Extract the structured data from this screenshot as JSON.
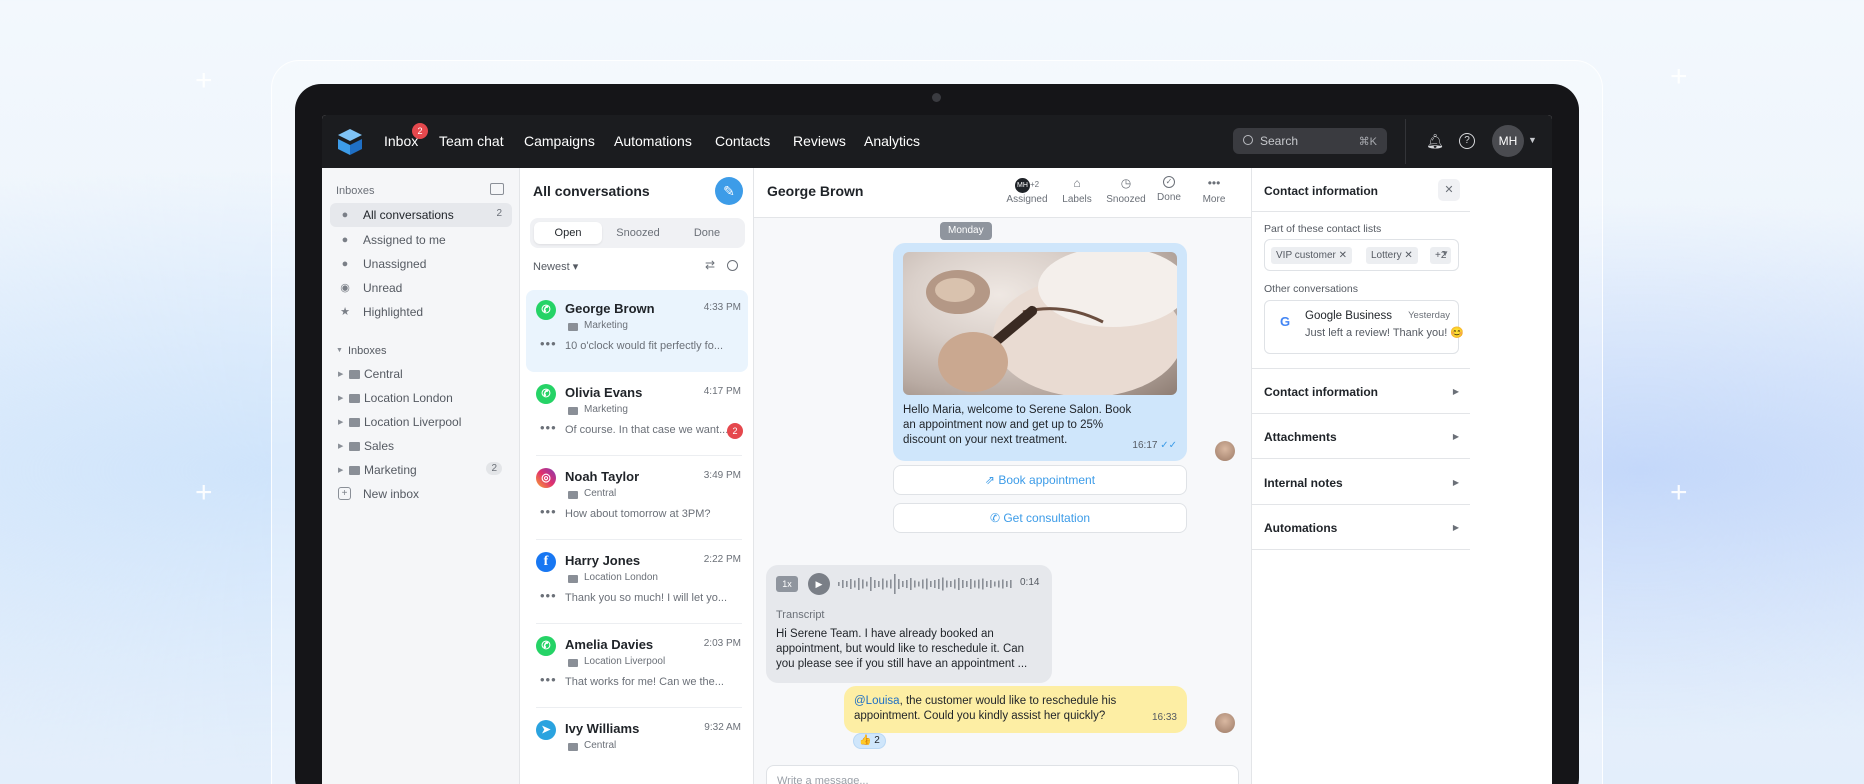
{
  "topnav": {
    "items": [
      "Inbox",
      "Team chat",
      "Campaigns",
      "Automations",
      "Contacts",
      "Reviews",
      "Analytics"
    ],
    "inbox_badge": "2",
    "search_placeholder": "Search",
    "search_shortcut": "⌘K",
    "user_initials": "MH"
  },
  "sidebar": {
    "header": "Inboxes",
    "items": [
      {
        "label": "All conversations",
        "count": "2"
      },
      {
        "label": "Assigned to me"
      },
      {
        "label": "Unassigned"
      },
      {
        "label": "Unread"
      },
      {
        "label": "Highlighted"
      }
    ],
    "section_title": "Inboxes",
    "inboxes": [
      {
        "label": "Central"
      },
      {
        "label": "Location London"
      },
      {
        "label": "Location Liverpool"
      },
      {
        "label": "Sales"
      },
      {
        "label": "Marketing",
        "count": "2"
      }
    ],
    "new_inbox": "New inbox"
  },
  "conversations": {
    "title": "All conversations",
    "tabs": [
      "Open",
      "Snoozed",
      "Done"
    ],
    "sort": "Newest",
    "items": [
      {
        "name": "George Brown",
        "time": "4:33 PM",
        "tag": "Marketing",
        "preview": "10 o'clock would fit perfectly fo...",
        "channel": "whatsapp"
      },
      {
        "name": "Olivia Evans",
        "time": "4:17 PM",
        "tag": "Marketing",
        "preview": "Of course. In that case we want...",
        "unread": "2",
        "channel": "whatsapp"
      },
      {
        "name": "Noah Taylor",
        "time": "3:49 PM",
        "tag": "Central",
        "preview": "How about tomorrow at 3PM?",
        "channel": "instagram"
      },
      {
        "name": "Harry Jones",
        "time": "2:22 PM",
        "tag": "Location London",
        "preview": "Thank you so much! I will let yo...",
        "channel": "facebook"
      },
      {
        "name": "Amelia Davies",
        "time": "2:03 PM",
        "tag": "Location Liverpool",
        "preview": "That works for me! Can we the...",
        "channel": "whatsapp"
      },
      {
        "name": "Ivy Williams",
        "time": "9:32 AM",
        "tag": "Central",
        "preview": "",
        "channel": "telegram"
      }
    ]
  },
  "chat": {
    "contact_name": "George Brown",
    "toolbar": {
      "assigned_avatar": "MH",
      "assigned_extra": "+2",
      "labels": [
        "Assigned",
        "Labels",
        "Snoozed",
        "Done",
        "More"
      ]
    },
    "day": "Monday",
    "outgoing_text": "Hello Maria, welcome to Serene Salon. Book an appointment now and get up to 25% discount on your next treatment.",
    "outgoing_time": "16:17",
    "quick_replies": [
      "Book appointment",
      "Get consultation"
    ],
    "voice": {
      "speed": "1x",
      "duration": "0:14",
      "transcript_label": "Transcript",
      "transcript": "Hi Serene Team. I have already booked an appointment, but would like to reschedule it. Can you please see if you still have an appointment ..."
    },
    "internal_note": {
      "mention": "@Louisa",
      "text": ", the customer would like to reschedule his appointment. Could you kindly assist her quickly?",
      "time": "16:33",
      "reaction_emoji": "👍",
      "reaction_count": "2"
    },
    "composer_placeholder": "Write a message..."
  },
  "contact_panel": {
    "title": "Contact information",
    "lists_label": "Part of these contact lists",
    "tags": [
      "VIP customer",
      "Lottery"
    ],
    "more_tags": "+2",
    "other_label": "Other conversations",
    "other": {
      "name": "Google Business",
      "time": "Yesterday",
      "message": "Just left a review! Thank you! 😊"
    },
    "sections": [
      "Contact information",
      "Attachments",
      "Internal notes",
      "Automations"
    ]
  },
  "colors": {
    "accent": "#3d9ce8",
    "nav_bg": "#1b1c1f",
    "badge": "#e5484d",
    "whatsapp": "#25d366",
    "facebook": "#1877f2",
    "telegram": "#2aa3df",
    "note_bg": "#fdeea4"
  }
}
